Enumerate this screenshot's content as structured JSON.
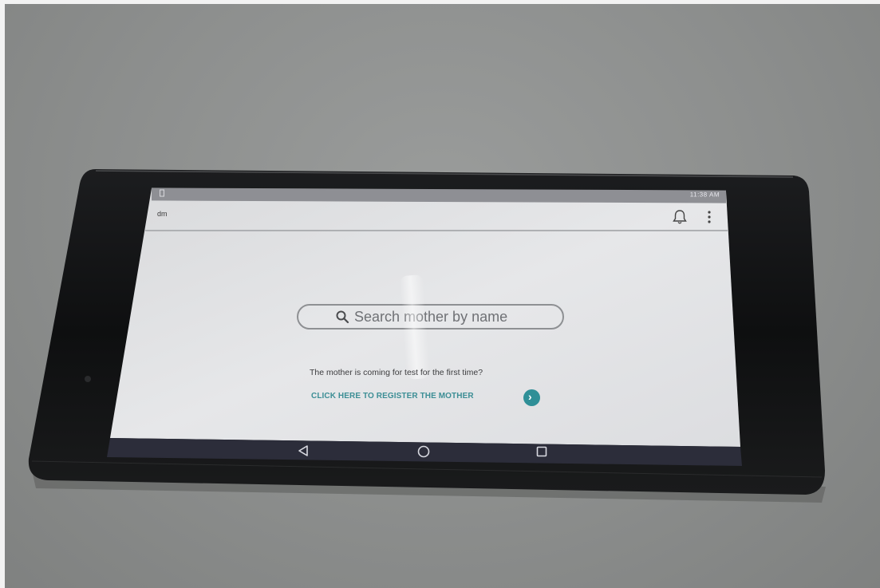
{
  "status_bar": {
    "time": "11:38 AM"
  },
  "header": {
    "title": "dm",
    "bell_icon": "bell-icon",
    "menu_icon": "more-vert-icon"
  },
  "search": {
    "placeholder": "Search mother by name",
    "icon": "search-icon"
  },
  "main": {
    "prompt": "The mother is coming for test for the first time?",
    "register_label": "CLICK HERE TO REGISTER THE MOTHER",
    "register_icon": "chevron-right-icon"
  },
  "navigation": {
    "back_icon": "back-icon",
    "home_icon": "home-icon",
    "recent_icon": "recent-apps-icon"
  },
  "colors": {
    "accent": "#2f8f97",
    "screen_bg": "#e2e3e5",
    "nav_bg": "#2c2d3a"
  }
}
